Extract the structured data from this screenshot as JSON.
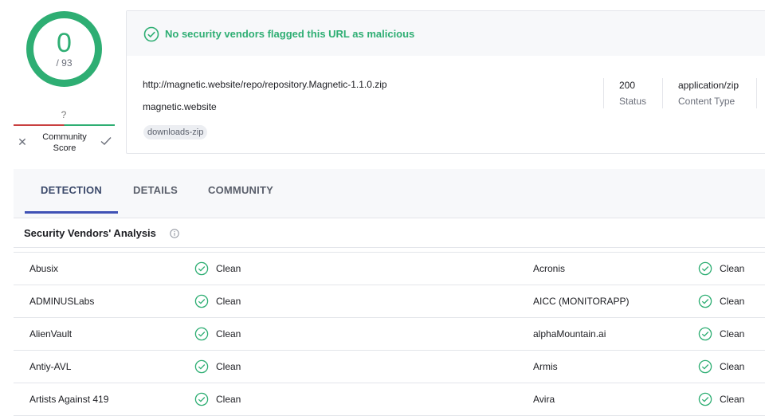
{
  "score": {
    "detections": "0",
    "total": "/ 93",
    "ring_color": "#2eae73"
  },
  "community": {
    "question": "?",
    "label": "Community Score",
    "dislike_icon": "x-icon",
    "like_icon": "check-icon"
  },
  "verdict": {
    "message": "No security vendors flagged this URL as malicious",
    "icon": "check-circle-icon",
    "color": "#2eae73"
  },
  "url_info": {
    "url": "http://magnetic.website/repo/repository.Magnetic-1.1.0.zip",
    "domain": "magnetic.website",
    "tag": "downloads-zip",
    "status_value": "200",
    "status_label": "Status",
    "content_type_value": "application/zip",
    "content_type_label": "Content Type"
  },
  "tabs": [
    {
      "label": "DETECTION",
      "active": true
    },
    {
      "label": "DETAILS",
      "active": false
    },
    {
      "label": "COMMUNITY",
      "active": false
    }
  ],
  "section": {
    "title": "Security Vendors' Analysis",
    "info_icon": "info-icon"
  },
  "vendors": [
    {
      "left_name": "Abusix",
      "left_status": "Clean",
      "right_name": "Acronis",
      "right_status": "Clean"
    },
    {
      "left_name": "ADMINUSLabs",
      "left_status": "Clean",
      "right_name": "AICC (MONITORAPP)",
      "right_status": "Clean"
    },
    {
      "left_name": "AlienVault",
      "left_status": "Clean",
      "right_name": "alphaMountain.ai",
      "right_status": "Clean"
    },
    {
      "left_name": "Antiy-AVL",
      "left_status": "Clean",
      "right_name": "Armis",
      "right_status": "Clean"
    },
    {
      "left_name": "Artists Against 419",
      "left_status": "Clean",
      "right_name": "Avira",
      "right_status": "Clean"
    }
  ]
}
